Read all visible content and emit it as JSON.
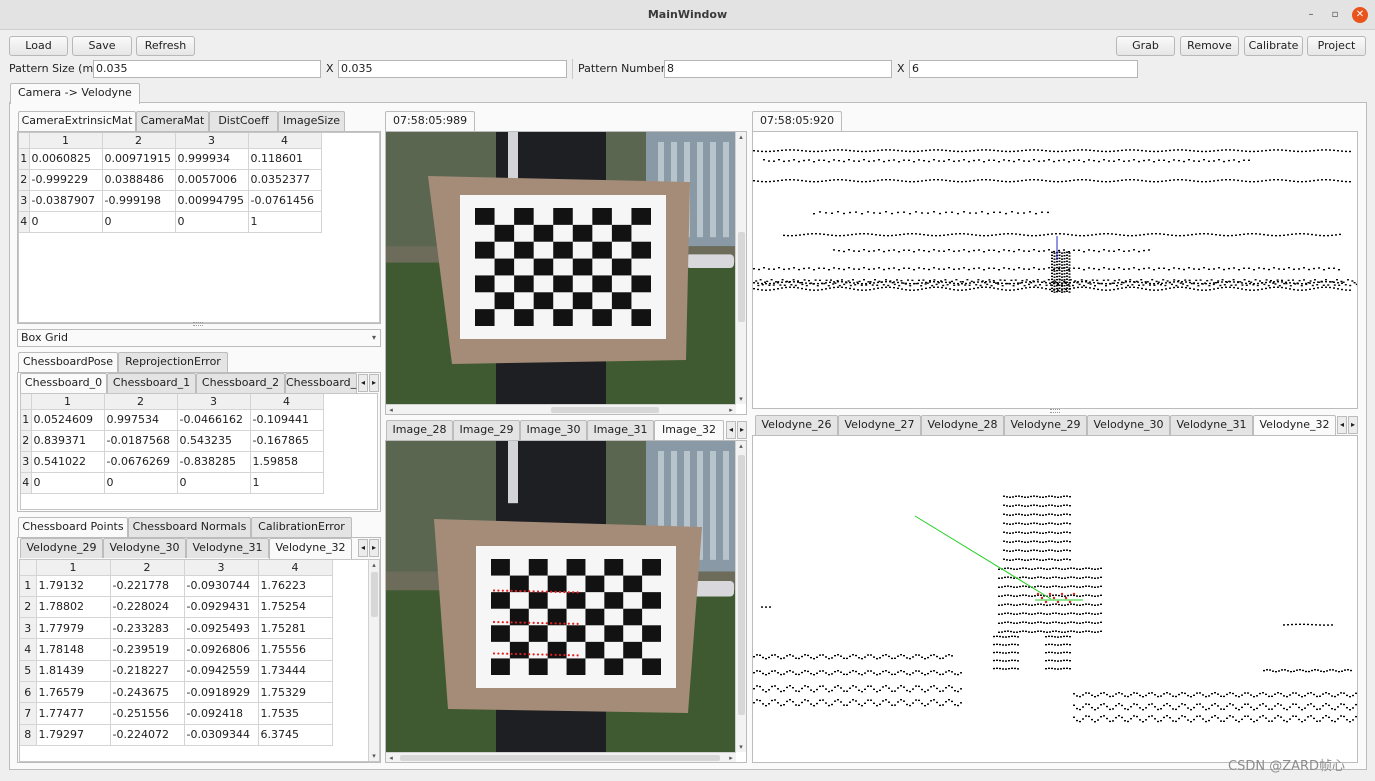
{
  "window": {
    "title": "MainWindow",
    "min_glyph": "–",
    "max_glyph": "▫",
    "close_glyph": "✕"
  },
  "toolbar": {
    "load": "Load",
    "save": "Save",
    "refresh": "Refresh",
    "grab": "Grab",
    "remove": "Remove",
    "calibrate": "Calibrate",
    "project": "Project"
  },
  "params": {
    "pattern_size_label": "Pattern Size (m)",
    "pattern_size_w": "0.035",
    "x1": "X",
    "pattern_size_h": "0.035",
    "pattern_number_label": "Pattern Number",
    "pattern_number_w": "8",
    "x2": "X",
    "pattern_number_h": "6"
  },
  "main_tab": "Camera -> Velodyne",
  "matrix_tabs": [
    "CameraExtrinsicMat",
    "CameraMat",
    "DistCoeff",
    "ImageSize"
  ],
  "extrinsic": {
    "headers": [
      "1",
      "2",
      "3",
      "4"
    ],
    "rows": [
      [
        "1",
        "0.0060825",
        "0.00971915",
        "0.999934",
        "0.118601"
      ],
      [
        "2",
        "-0.999229",
        "0.0388486",
        "0.0057006",
        "0.0352377"
      ],
      [
        "3",
        "-0.0387907",
        "-0.999198",
        "0.00994795",
        "-0.0761456"
      ],
      [
        "4",
        "0",
        "0",
        "0",
        "1"
      ]
    ]
  },
  "box_grid": "Box Grid",
  "pose_tabs": [
    "ChessboardPose",
    "ReprojectionError"
  ],
  "chessboard_tabs": [
    "Chessboard_0",
    "Chessboard_1",
    "Chessboard_2",
    "Chessboard_"
  ],
  "pose": {
    "headers": [
      "1",
      "2",
      "3",
      "4"
    ],
    "rows": [
      [
        "1",
        "0.0524609",
        "0.997534",
        "-0.0466162",
        "-0.109441"
      ],
      [
        "2",
        "0.839371",
        "-0.0187568",
        "0.543235",
        "-0.167865"
      ],
      [
        "3",
        "0.541022",
        "-0.0676269",
        "-0.838285",
        "1.59858"
      ],
      [
        "4",
        "0",
        "0",
        "0",
        "1"
      ]
    ]
  },
  "points_tabs": [
    "Chessboard Points",
    "Chessboard Normals",
    "CalibrationError"
  ],
  "velo_tabs_left": [
    "Velodyne_29",
    "Velodyne_30",
    "Velodyne_31",
    "Velodyne_32"
  ],
  "points": {
    "headers": [
      "1",
      "2",
      "3",
      "4"
    ],
    "rows": [
      [
        "1",
        "1.79132",
        "-0.221778",
        "-0.0930744",
        "1.76223"
      ],
      [
        "2",
        "1.78802",
        "-0.228024",
        "-0.0929431",
        "1.75254"
      ],
      [
        "3",
        "1.77979",
        "-0.233283",
        "-0.0925493",
        "1.75281"
      ],
      [
        "4",
        "1.78148",
        "-0.239519",
        "-0.0926806",
        "1.75556"
      ],
      [
        "5",
        "1.81439",
        "-0.218227",
        "-0.0942559",
        "1.73444"
      ],
      [
        "6",
        "1.76579",
        "-0.243675",
        "-0.0918929",
        "1.75329"
      ],
      [
        "7",
        "1.77477",
        "-0.251556",
        "-0.092418",
        "1.7535"
      ],
      [
        "8",
        "1.79297",
        "-0.224072",
        "-0.0309344",
        "6.3745"
      ]
    ]
  },
  "image_view": {
    "timestamp": "07:58:05:989"
  },
  "image_tabs": [
    "Image_28",
    "Image_29",
    "Image_30",
    "Image_31",
    "Image_32"
  ],
  "velo_view": {
    "timestamp": "07:58:05:920"
  },
  "velo_tabs_right": [
    "Velodyne_26",
    "Velodyne_27",
    "Velodyne_28",
    "Velodyne_29",
    "Velodyne_30",
    "Velodyne_31",
    "Velodyne_32"
  ],
  "scroll": {
    "left": "◂",
    "right": "▸",
    "up": "▴",
    "down": "▾",
    "combo": "▾"
  },
  "watermark": "CSDN @ZARD帧心",
  "colors": {
    "close": "#e9541d",
    "grass": "#3f5a30",
    "board": "#a48c78",
    "green_line": "#22d022",
    "red_pts": "#e02020",
    "blue_axis": "#2a2ac8"
  }
}
